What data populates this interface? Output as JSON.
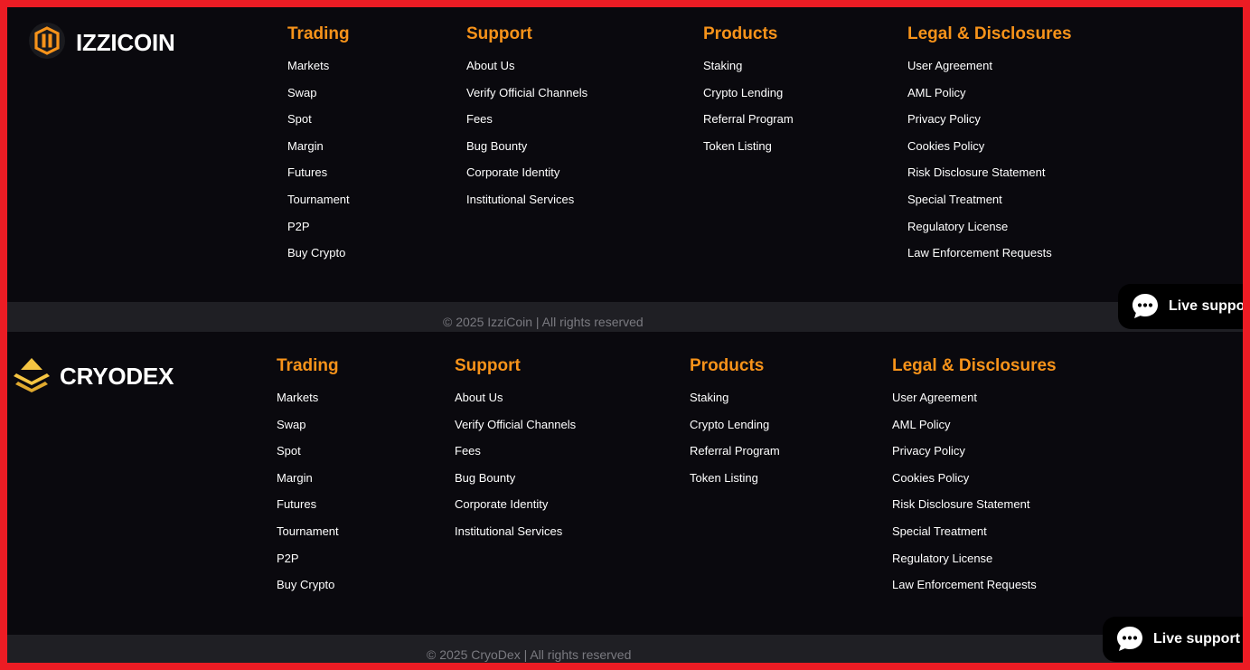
{
  "footers": [
    {
      "brand": {
        "name": "IZZICOIN",
        "logo_icon": "izzicoin-logo-icon",
        "accent": "#f7931a"
      },
      "columns": [
        {
          "title": "Trading",
          "links": [
            "Markets",
            "Swap",
            "Spot",
            "Margin",
            "Futures",
            "Tournament",
            "P2P",
            "Buy Crypto"
          ]
        },
        {
          "title": "Support",
          "links": [
            "About Us",
            "Verify Official Channels",
            "Fees",
            "Bug Bounty",
            "Corporate Identity",
            "Institutional Services"
          ]
        },
        {
          "title": "Products",
          "links": [
            "Staking",
            "Crypto Lending",
            "Referral Program",
            "Token Listing"
          ]
        },
        {
          "title": "Legal & Disclosures",
          "links": [
            "User Agreement",
            "AML Policy",
            "Privacy Policy",
            "Cookies Policy",
            "Risk Disclosure Statement",
            "Special Treatment",
            "Regulatory License",
            "Law Enforcement Requests"
          ]
        }
      ],
      "copyright": "© 2025 IzziCoin | All rights reserved",
      "live_support": {
        "label": "Live support",
        "icon": "chat-bubble-icon"
      }
    },
    {
      "brand": {
        "name": "CRYODEX",
        "logo_icon": "cryodex-logo-icon",
        "accent": "#f5c542"
      },
      "columns": [
        {
          "title": "Trading",
          "links": [
            "Markets",
            "Swap",
            "Spot",
            "Margin",
            "Futures",
            "Tournament",
            "P2P",
            "Buy Crypto"
          ]
        },
        {
          "title": "Support",
          "links": [
            "About Us",
            "Verify Official Channels",
            "Fees",
            "Bug Bounty",
            "Corporate Identity",
            "Institutional Services"
          ]
        },
        {
          "title": "Products",
          "links": [
            "Staking",
            "Crypto Lending",
            "Referral Program",
            "Token Listing"
          ]
        },
        {
          "title": "Legal & Disclosures",
          "links": [
            "User Agreement",
            "AML Policy",
            "Privacy Policy",
            "Cookies Policy",
            "Risk Disclosure Statement",
            "Special Treatment",
            "Regulatory License",
            "Law Enforcement Requests"
          ]
        }
      ],
      "copyright": "© 2025 CryoDex | All rights reserved",
      "live_support": {
        "label": "Live support",
        "icon": "chat-bubble-icon"
      }
    }
  ],
  "colors": {
    "page_border": "#ec1c24",
    "background": "#0a090e",
    "copyright_bar": "#1f1f24",
    "heading": "#f7931a",
    "link": "#ffffff",
    "muted_text": "#7a7a80"
  }
}
